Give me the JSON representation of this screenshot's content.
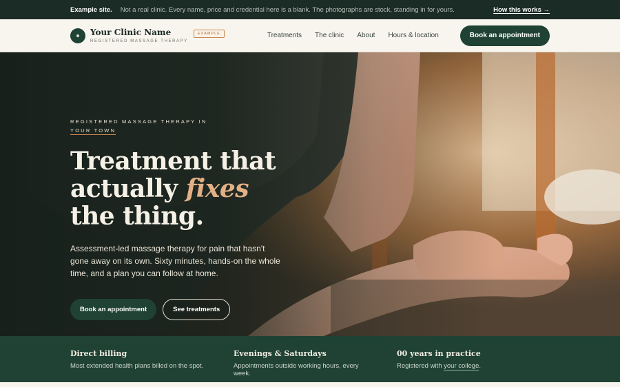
{
  "notice": {
    "tag": "Example site.",
    "message": "Not a real clinic. Every name, price and credential here is a blank. The photographs are stock, standing in for yours.",
    "how_link": "How this works →"
  },
  "header": {
    "clinic_name": "Your Clinic Name",
    "clinic_sub": "REGISTERED MASSAGE THERAPY",
    "badge": "EXAMPLE",
    "nav": [
      "Treatments",
      "The clinic",
      "About",
      "Hours & location"
    ],
    "book_label": "Book an appointment"
  },
  "hero": {
    "eyebrow_line1": "REGISTERED MASSAGE THERAPY IN",
    "eyebrow_town": "YOUR TOWN",
    "headline_part1": "Treatment that actually ",
    "headline_em": "fixes",
    "headline_part2": " the thing.",
    "lede": "Assessment-led massage therapy for pain that hasn't gone away on its own. Sixty minutes, hands-on the whole time, and a plan you can follow at home.",
    "primary_cta": "Book an appointment",
    "secondary_cta": "See treatments"
  },
  "features": [
    {
      "title": "Direct billing",
      "text": "Most extended health plans billed on the spot."
    },
    {
      "title": "Evenings & Saturdays",
      "text": "Appointments outside working hours, every week."
    },
    {
      "title": "00 years in practice",
      "text_before": "Registered with ",
      "link": "your college",
      "text_after": "."
    }
  ],
  "colors": {
    "brand_green": "#1f4234",
    "notice_bg": "#1b2b25",
    "accent": "#e3b085"
  }
}
